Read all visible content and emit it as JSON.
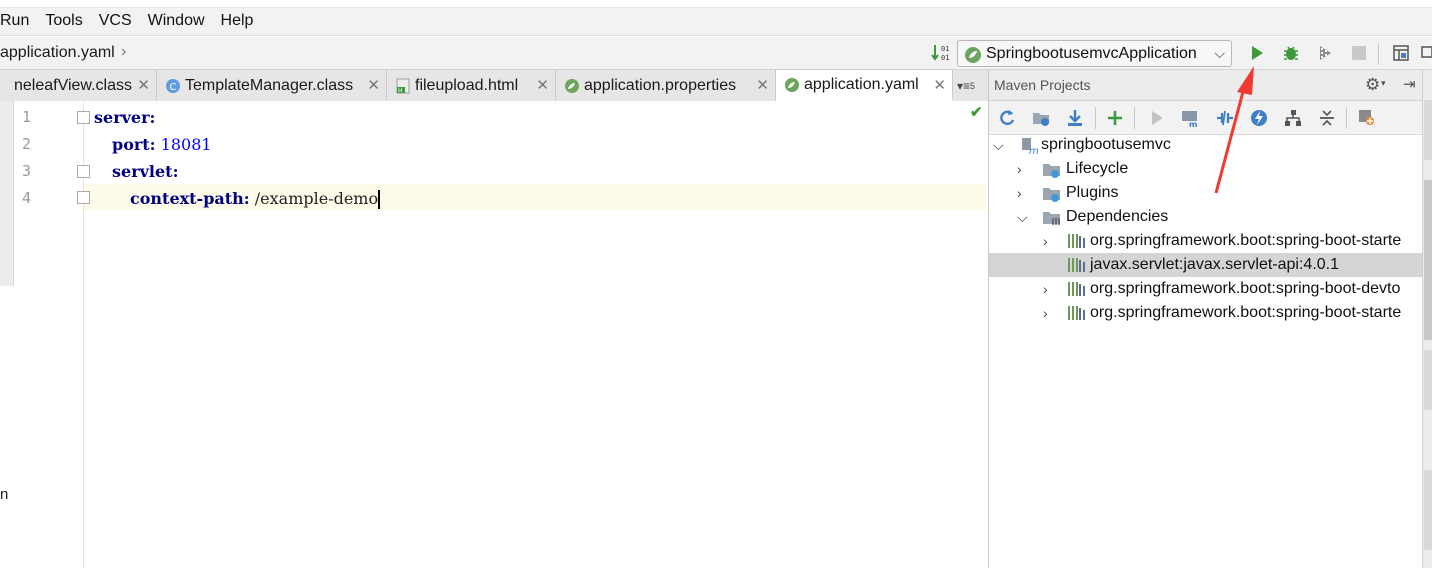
{
  "menu": [
    "Run",
    "Tools",
    "VCS",
    "Window",
    "Help"
  ],
  "breadcrumb": "application.yaml",
  "run_config": {
    "label": "SpringbootusemvcApplication"
  },
  "tabs": [
    {
      "label": "neleafView.class",
      "icon": "class-file-icon"
    },
    {
      "label": "TemplateManager.class",
      "icon": "class-c-icon"
    },
    {
      "label": "fileupload.html",
      "icon": "html-file-icon"
    },
    {
      "label": "application.properties",
      "icon": "spring-leaf-icon"
    },
    {
      "label": "application.yaml",
      "icon": "spring-leaf-icon",
      "active": true
    }
  ],
  "tab_overflow": "5",
  "editor": {
    "lines": [
      {
        "num": "1",
        "key": "server:",
        "value": ""
      },
      {
        "num": "2",
        "key": "port:",
        "value": "18081"
      },
      {
        "num": "3",
        "key": "servlet:",
        "value": ""
      },
      {
        "num": "4",
        "key": "context-path:",
        "value": "/example-demo"
      }
    ],
    "left_orphan_text": "n"
  },
  "maven": {
    "title": "Maven Projects",
    "project": "springbootusemvc",
    "nodes": [
      "Lifecycle",
      "Plugins",
      "Dependencies"
    ],
    "dependencies": [
      "org.springframework.boot:spring-boot-starte",
      "javax.servlet:javax.servlet-api:4.0.1",
      "org.springframework.boot:spring-boot-devto",
      "org.springframework.boot:spring-boot-starte"
    ],
    "selected_dependency_index": 1
  },
  "colors": {
    "accent_run": "#3c9a3c",
    "annotation_arrow": "#f03a2f",
    "key_color": "#000080",
    "number_color": "#0000ff"
  }
}
